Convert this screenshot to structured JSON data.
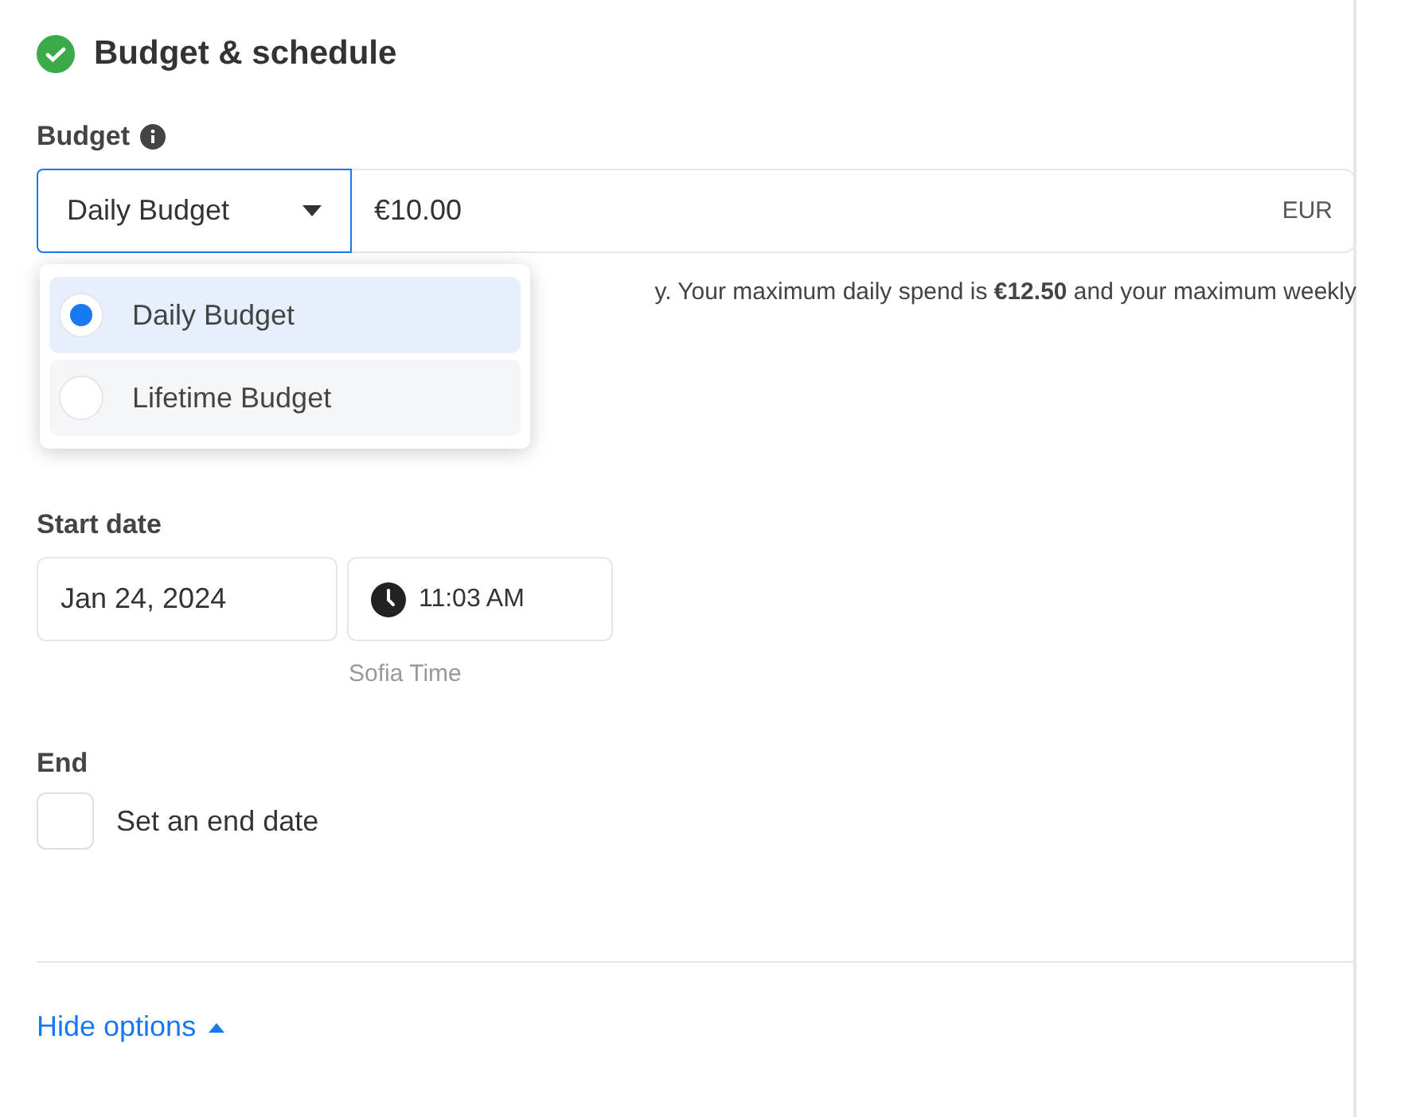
{
  "section": {
    "title": "Budget & schedule",
    "complete": true
  },
  "budget": {
    "label": "Budget",
    "type_select": {
      "value": "Daily Budget",
      "open": true
    },
    "amount": "€10.00",
    "currency": "EUR",
    "help": "y. Your maximum daily spend is **€12.50** and your maximum weekly",
    "options": [
      {
        "label": "Daily Budget",
        "selected": true
      },
      {
        "label": "Lifetime Budget",
        "selected": false
      }
    ]
  },
  "start": {
    "label": "Start date",
    "date": "Jan 24, 2024",
    "time": "11:03 AM",
    "timezone": "Sofia Time"
  },
  "end": {
    "label": "End",
    "checkbox": {
      "label": "Set an end date",
      "checked": false
    }
  },
  "footer": {
    "link": "Hide options",
    "expanded": true
  }
}
